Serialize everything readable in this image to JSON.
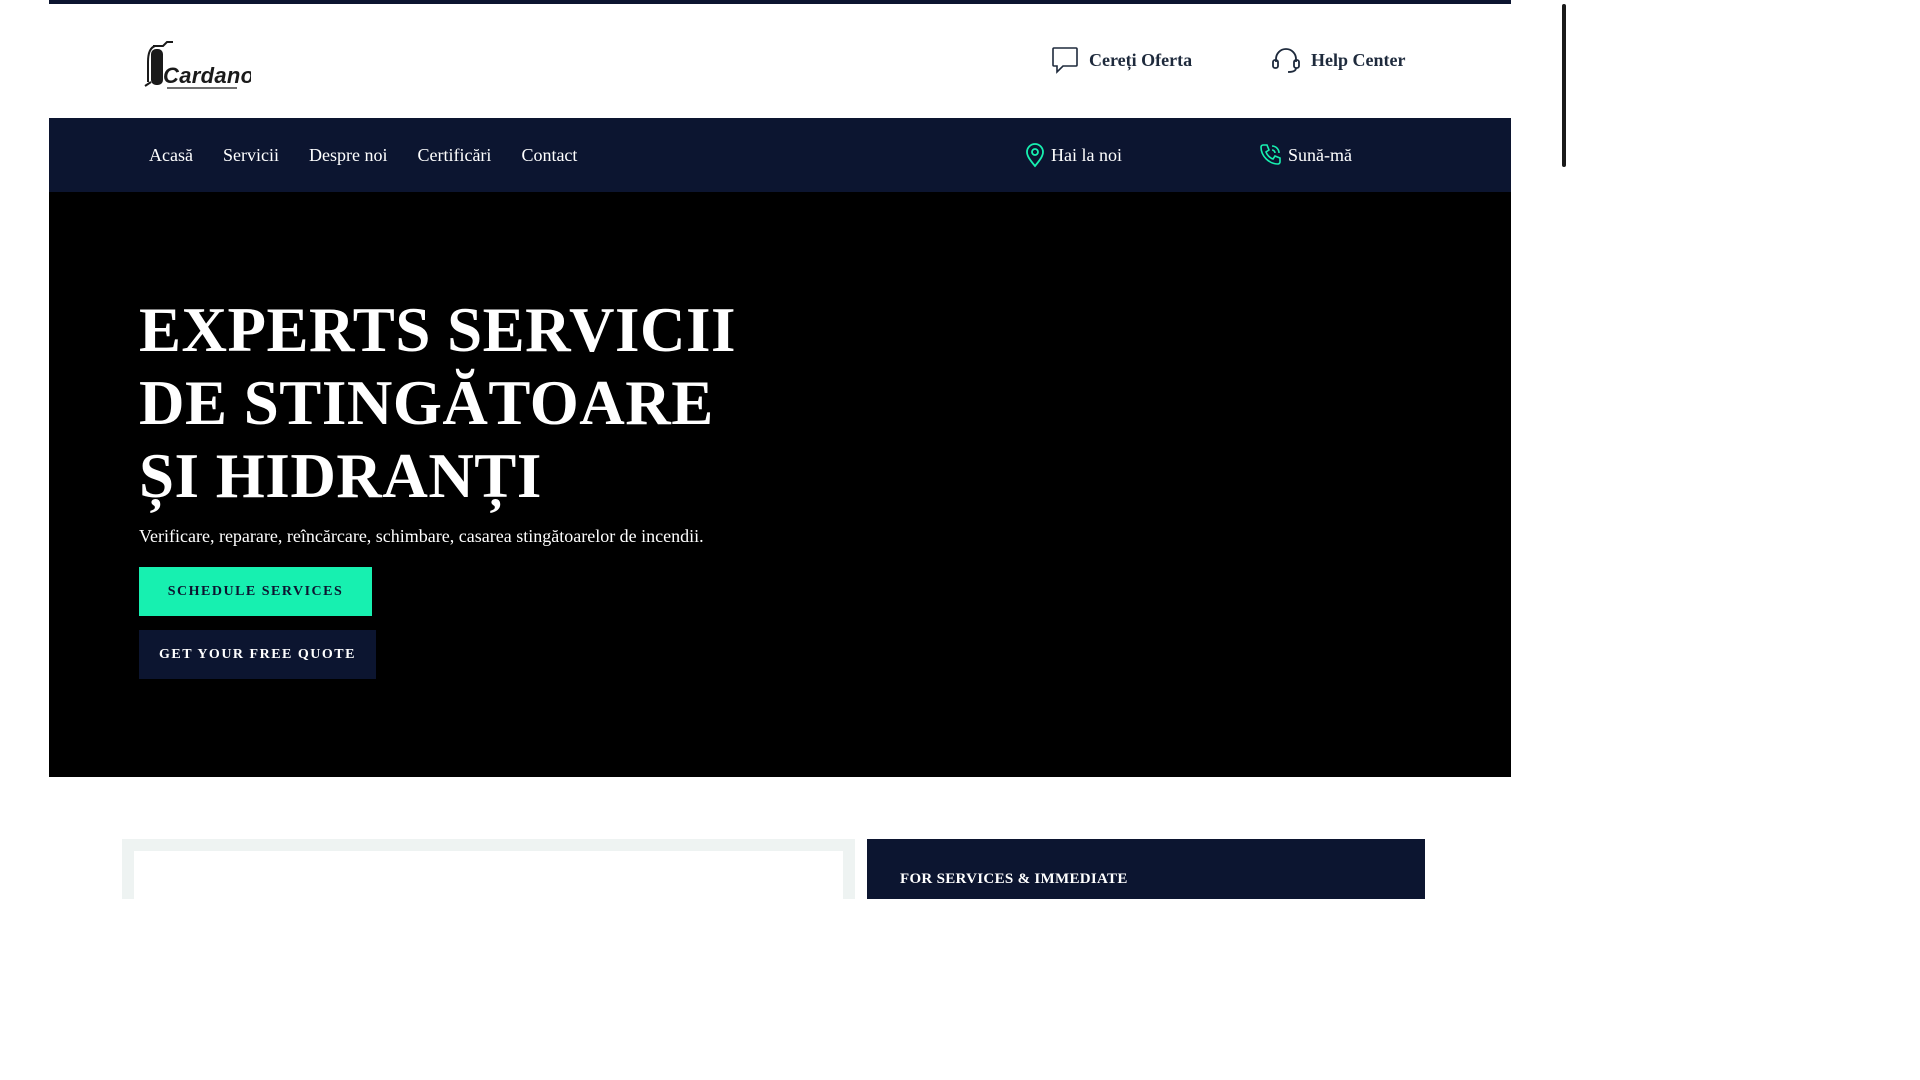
{
  "brand": {
    "logo_text": "Cardano"
  },
  "header": {
    "offer_label": "Cereți Oferta",
    "help_label": "Help Center"
  },
  "nav": {
    "items": [
      {
        "label": "Acasă"
      },
      {
        "label": "Servicii"
      },
      {
        "label": "Despre noi"
      },
      {
        "label": "Certificări"
      },
      {
        "label": "Contact"
      }
    ],
    "location_label": "Hai la noi",
    "call_label": "Sună-mă"
  },
  "hero": {
    "title_lines": [
      "EXPERTS SERVICII",
      "DE STINGĂTOARE",
      "ȘI HIDRANȚI"
    ],
    "subtitle": "Verificare, reparare, reîncărcare, schimbare, casarea stingătoarelor de incendii.",
    "primary_button": "SCHEDULE SERVICES",
    "secondary_button": "GET YOUR FREE QUOTE"
  },
  "lower": {
    "right_card_text": "FOR SERVICES & IMMEDIATE"
  },
  "colors": {
    "navy": "#0c1530",
    "accent": "#17f0b0",
    "hero_bg": "#000000"
  },
  "icons": {
    "offer": "chat-bubble-icon",
    "help": "headset-icon",
    "location": "map-pin-icon",
    "call": "phone-icon",
    "logo": "fire-extinguisher-icon"
  }
}
